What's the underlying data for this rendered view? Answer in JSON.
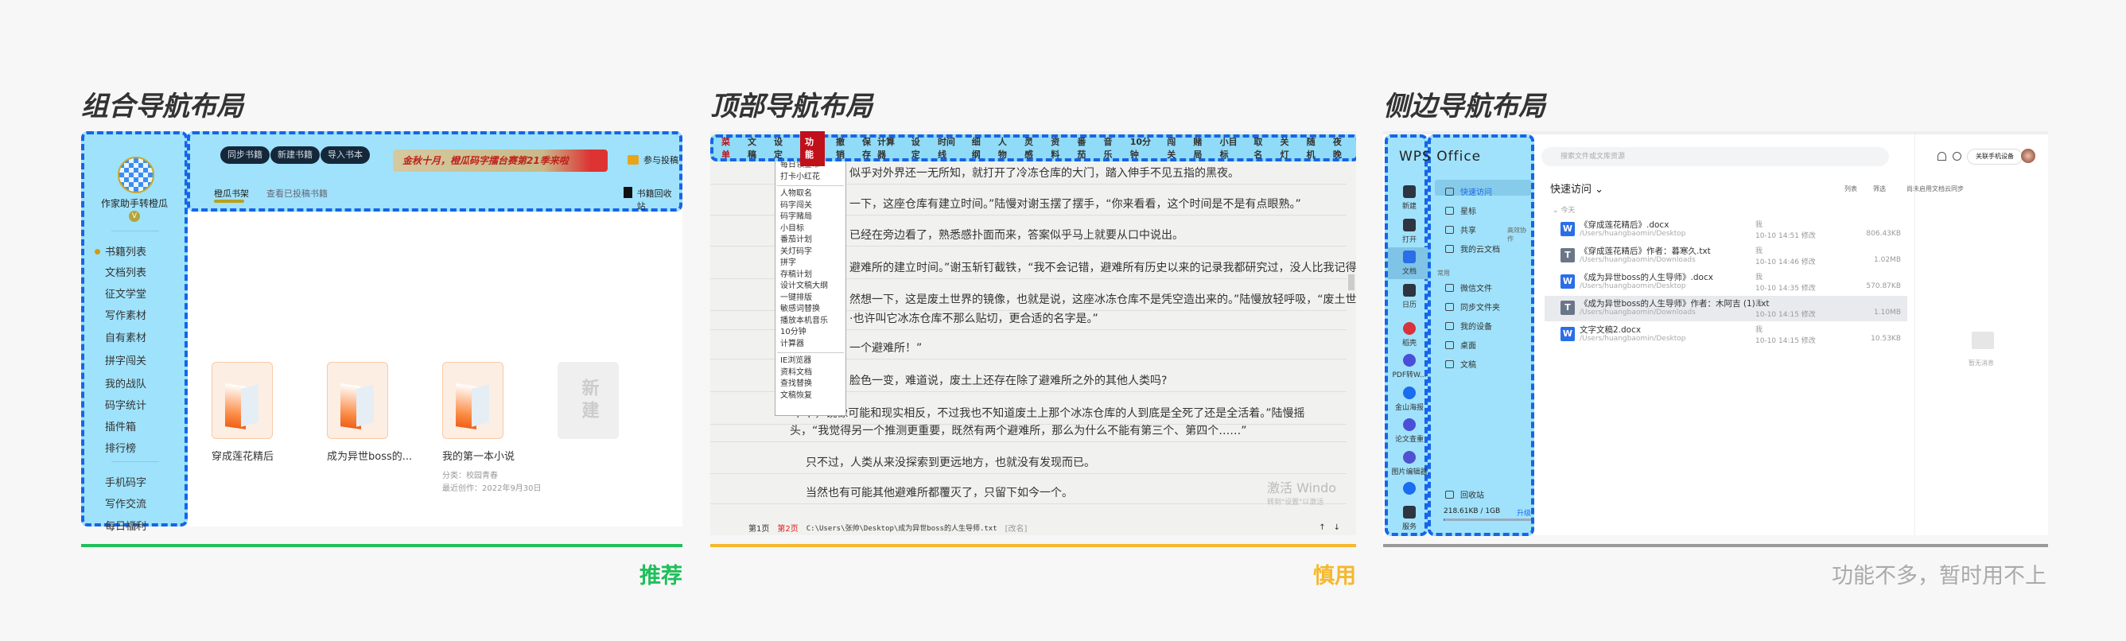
{
  "panel1": {
    "title": "组合导航布局",
    "verdict": "推荐",
    "colors": {
      "accent": "#1fbf5a"
    },
    "user_name": "作家助手转橙瓜",
    "vip_badge": "V",
    "nav": [
      "书籍列表",
      "文档列表",
      "征文学堂",
      "写作素材",
      "自有素材",
      "拼字闯关",
      "我的战队",
      "码字统计",
      "插件箱",
      "排行榜"
    ],
    "nav2": [
      "手机码字",
      "写作交流",
      "每日福利"
    ],
    "buttons": [
      "同步书籍",
      "新建书籍",
      "导入书本"
    ],
    "banner": "金秋十月，橙瓜码字擂台赛第21季来啦",
    "contribute": "参与投稿",
    "tabs": [
      "橙瓜书架",
      "查看已投稿书籍"
    ],
    "recycle": "书籍回收站",
    "books": [
      {
        "title": "穿成莲花精后"
      },
      {
        "title": "成为异世boss的..."
      },
      {
        "title": "我的第一本小说",
        "category": "分类：校园青春",
        "recent": "最近创作：2022年9月30日"
      }
    ],
    "new_card": "新建"
  },
  "panel2": {
    "title": "顶部导航布局",
    "verdict": "慎用",
    "colors": {
      "accent": "#f5b82e"
    },
    "toolbar_left": [
      "菜单",
      "文稿",
      "设定",
      "功能",
      "撤销",
      "保存"
    ],
    "toolbar_right": [
      "计算器",
      "设定",
      "时间线",
      "细纲",
      "人物",
      "灵感",
      "资料",
      "番茄",
      "音乐",
      "10分钟",
      "闯关",
      "赌局",
      "小目标",
      "取名",
      "关灯",
      "随机",
      "夜晚"
    ],
    "menu_groups": [
      [
        "每日领金币",
        "打卡小红花"
      ],
      [
        "人物取名",
        "码字闯关",
        "码字赌局",
        "小目标",
        "番茄计划",
        "关灯码字",
        "拼字",
        "存稿计划",
        "设计文稿大纲",
        "一键排版",
        "敏感词替换",
        "播放本机音乐",
        "10分钟",
        "计算器"
      ],
      [
        "IE浏览器",
        "资料文档",
        "查找替换",
        "文稿恢复"
      ]
    ],
    "lines": [
      "似乎对外界还一无所知，就打开了冷冻仓库的大门，踏入伸手不见五指的黑夜。",
      "一下，这座仓库有建立时间。”陆慢对谢玉摆了摆手，“你来看看，这个时间是不是有点眼熟。”",
      "已经在旁边看了，熟悉感扑面而来，答案似乎马上就要从口中说出。",
      "避难所的建立时间。”谢玉斩钉截铁，“我不会记错，避难所有历史以来的记录我都研究过，没人比我记得",
      "然想一下，这是废土世界的镜像，也就是说，这座冰冻仓库不是凭空造出来的。”陆慢放轻呼吸，“废土世",
      "·也许叫它冰冻仓库不那么贴切，更合适的名字是。”",
      "一个避难所！”",
      "脸色一变，难道说，废土上还存在除了避难所之外的其他人类吗?",
      "“不不，镜像可能和现实相反，不过我也不知道废土上那个冰冻仓库的人到底是全死了还是全活着。”陆慢摇",
      "头，“我觉得另一个推测更重要，既然有两个避难所，那么为什么不能有第三个、第四个……”",
      "只不过，人类从来没探索到更远地方，也就没有发现而已。",
      "当然也有可能其他避难所都覆灭了，只留下如今一个。"
    ],
    "watermark": [
      "激活 Windo",
      "转到\"设置\"以激活"
    ],
    "status": {
      "page1": "第1页",
      "page2": "第2页",
      "path": "C:\\Users\\张帅\\Desktop\\成为异世boss的人生导师.txt",
      "rename": "[改名]",
      "up": "↑",
      "down": "↓"
    }
  },
  "panel3": {
    "title": "侧边导航布局",
    "verdict": "功能不多，暂时用不上",
    "logo": "WPS Office",
    "rail": [
      "新建",
      "打开",
      "文档",
      "日历",
      "稻壳",
      "PDF转W...",
      "金山海报",
      "论文查重",
      "图片编辑器",
      "",
      "服务"
    ],
    "sidebar": [
      "快速访问",
      "星标",
      "共享",
      "我的云文档"
    ],
    "collab": "高效协作",
    "common_label": "常用",
    "common": [
      "微信文件",
      "同步文件夹",
      "我的设备",
      "桌面",
      "文稿"
    ],
    "recycle": "回收站",
    "storage": "218.61KB / 1GB",
    "storage_fraction": 0.0002,
    "upgrade": "升级",
    "search_placeholder": "搜索文件或文库资源",
    "link_phone": "关联手机设备",
    "section": "快速访问 ⌄",
    "view_list": "列表",
    "filter": "筛选",
    "cloud": "尚未启用文档云同步",
    "today": "⌄ 今天",
    "files": [
      {
        "type": "W",
        "name": "《穿成莲花精后》.docx",
        "path": "/Users/huangbaomin/Desktop",
        "by": "我",
        "time": "10-10 14:51 修改",
        "size": "806.43KB"
      },
      {
        "type": "T",
        "name": "《穿成莲花精后》作者：暮寒久.txt",
        "path": "/Users/huangbaomin/Downloads",
        "by": "我",
        "time": "10-10 14:46 修改",
        "size": "1.02MB"
      },
      {
        "type": "W",
        "name": "《成为异世boss的人生导师》.docx",
        "path": "/Users/huangbaomin/Desktop",
        "by": "我",
        "time": "10-10 14:35 修改",
        "size": "570.87KB"
      },
      {
        "type": "T",
        "name": "《成为异世boss的人生导师》作者：木阿吉 (1).txt",
        "path": "/Users/huangbaomin/Downloads",
        "by": "我",
        "time": "10-10 14:15 修改",
        "size": "1.10MB"
      },
      {
        "type": "W",
        "name": "文字文稿2.docx",
        "path": "/Users/huangbaomin/Desktop",
        "by": "我",
        "time": "10-10 14:15 修改",
        "size": "10.53KB"
      }
    ],
    "empty": "暂无消息"
  }
}
